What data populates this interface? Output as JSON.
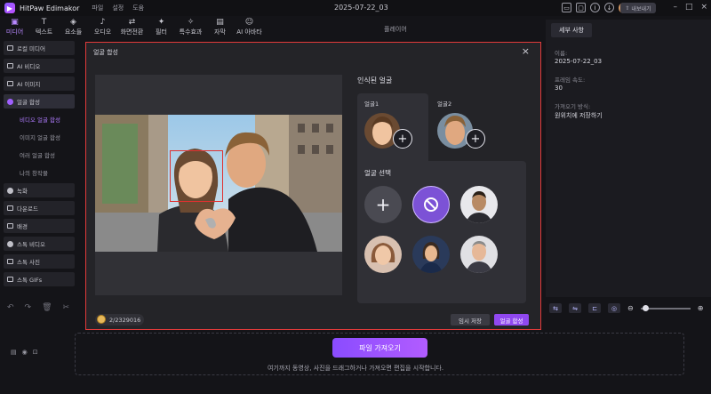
{
  "app": {
    "name": "HitPaw Edimakor",
    "menu": [
      "파일",
      "설정",
      "도움"
    ],
    "doc_title": "2025-07-22_03",
    "export_label": "내보내기"
  },
  "toolbar": {
    "items": [
      {
        "label": "미디어",
        "icon": "media-icon"
      },
      {
        "label": "텍스트",
        "icon": "text-icon"
      },
      {
        "label": "요소들",
        "icon": "elements-icon"
      },
      {
        "label": "오디오",
        "icon": "audio-icon"
      },
      {
        "label": "화면전환",
        "icon": "transition-icon"
      },
      {
        "label": "필터",
        "icon": "filter-icon"
      },
      {
        "label": "특수효과",
        "icon": "effects-icon"
      },
      {
        "label": "자막",
        "icon": "subtitle-icon"
      },
      {
        "label": "AI 아바타",
        "icon": "avatar-icon"
      }
    ]
  },
  "sidebar": {
    "items": [
      {
        "label": "로컬 미디어"
      },
      {
        "label": "AI 비디오"
      },
      {
        "label": "AI 이미지"
      },
      {
        "label": "얼굴 합성"
      }
    ],
    "subitems": [
      "비디오 얼굴 합성",
      "이미지 얼굴 합성",
      "여러 얼굴 합성",
      "나의 창작물"
    ],
    "items2": [
      {
        "label": "녹화"
      },
      {
        "label": "다운로드"
      },
      {
        "label": "배경"
      },
      {
        "label": "스톡 비디오"
      },
      {
        "label": "스톡 사진"
      },
      {
        "label": "스톡 GIFs"
      }
    ]
  },
  "player": {
    "label": "플레이어"
  },
  "details": {
    "tab": "세부 사항",
    "name_label": "이름:",
    "name_value": "2025-07-22_03",
    "fps_label": "프레임 속도:",
    "fps_value": "30",
    "save_label": "가져오기 방식:",
    "save_value": "원위치에 저장하기"
  },
  "timeline": {
    "import_label": "파일 가져오기",
    "hint": "여기까지 동영상, 사진을 드래그하거나 가져오면 편집을 시작합니다."
  },
  "modal": {
    "title": "얼굴 합성",
    "detected_title": "인식된 얼굴",
    "faces": [
      {
        "label": "얼굴1"
      },
      {
        "label": "얼굴2"
      }
    ],
    "select_title": "얼굴 선택",
    "credits": "2/2329016",
    "save_label": "임시 저장",
    "swap_label": "얼굴 합성"
  },
  "colors": {
    "accent": "#9048f0",
    "highlight": "#e23a3a"
  }
}
